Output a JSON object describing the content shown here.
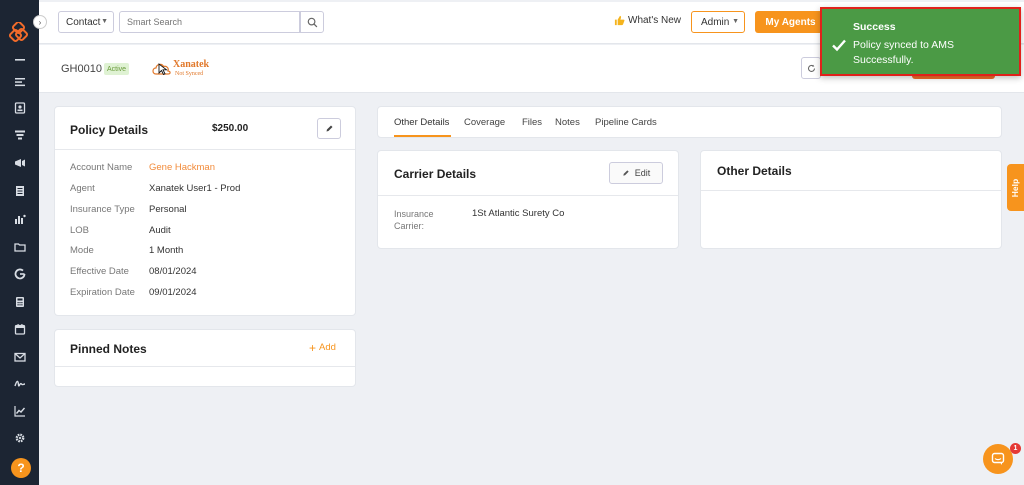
{
  "topbar": {
    "contact_dropdown": "Contact",
    "search_placeholder": "Smart Search",
    "whats_new": "What's New",
    "admin_dropdown": "Admin",
    "my_agents": "My Agents"
  },
  "policy_header": {
    "policy_id": "GH0010",
    "status": "Active",
    "carrier_logo_name": "Xanatek",
    "carrier_logo_sub": "Not Synced"
  },
  "policy_details": {
    "title": "Policy Details",
    "price": "$250.00",
    "fields": [
      {
        "label": "Account Name",
        "value": "Gene Hackman"
      },
      {
        "label": "Agent",
        "value": "Xanatek User1 - Prod"
      },
      {
        "label": "Insurance Type",
        "value": "Personal"
      },
      {
        "label": "LOB",
        "value": "Audit"
      },
      {
        "label": "Mode",
        "value": "1 Month"
      },
      {
        "label": "Effective Date",
        "value": "08/01/2024"
      },
      {
        "label": "Expiration Date",
        "value": "09/01/2024"
      }
    ]
  },
  "pinned_notes": {
    "title": "Pinned Notes",
    "add_label": "Add"
  },
  "tabs": [
    {
      "label": "Other Details",
      "active": true
    },
    {
      "label": "Coverage",
      "active": false
    },
    {
      "label": "Files",
      "active": false
    },
    {
      "label": "Notes",
      "active": false
    },
    {
      "label": "Pipeline Cards",
      "active": false
    }
  ],
  "carrier_details": {
    "title": "Carrier Details",
    "edit_label": "Edit",
    "field_label": "Insurance Carrier:",
    "field_value": "1St Atlantic Surety Co"
  },
  "other_details": {
    "title": "Other Details"
  },
  "help_tab": "Help",
  "chat": {
    "badge": "1"
  },
  "toast": {
    "title": "Success",
    "message": "Policy synced to AMS Successfully."
  },
  "colors": {
    "accent": "#f7941d",
    "sidebar": "#1c2533",
    "toast_bg": "#4b9a45",
    "toast_border": "#e0211b",
    "link": "#f28b3a"
  }
}
